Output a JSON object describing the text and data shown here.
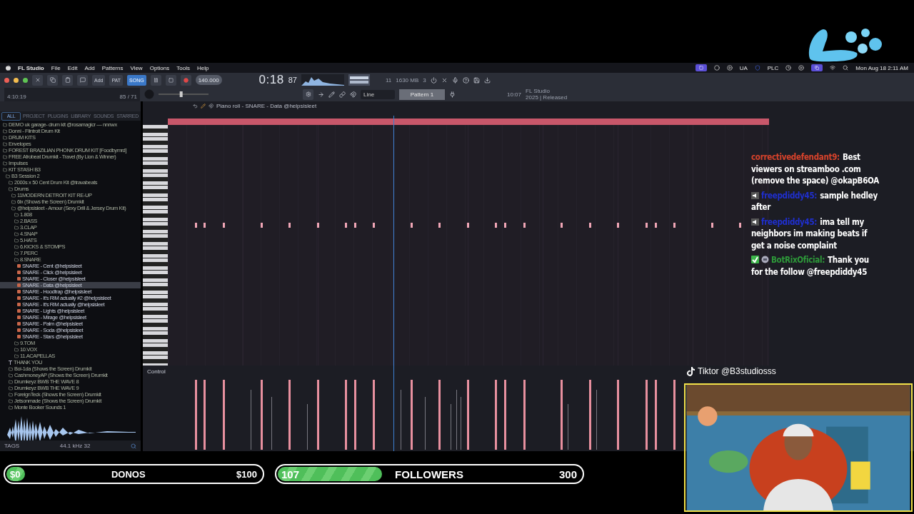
{
  "menu_bar": {
    "app": "FL Studio",
    "items": [
      "File",
      "Edit",
      "Add",
      "Patterns",
      "View",
      "Options",
      "Tools",
      "Help"
    ],
    "status_texts": [
      "UA",
      "PLC"
    ],
    "clock": "Mon Aug 18  2:11 AM"
  },
  "toolbar": {
    "add_label": "Add",
    "modes": [
      {
        "label": "PAT",
        "selected": false
      },
      {
        "label": "SONG",
        "selected": true
      }
    ],
    "tempo": "140.000",
    "pitch": {
      "level": 0.45
    },
    "time_main": "0:18",
    "time_cs": "87",
    "cpu": "11",
    "memory": "1630 MB",
    "voices": "3",
    "hint_time": "4:10:19",
    "hint_counts": "85 / 71",
    "snap": "Line",
    "pattern": "Pattern 1",
    "version_time": "10:07",
    "version_name": "FL Studio",
    "version_release": "2025 | Released"
  },
  "browser": {
    "tabs": [
      {
        "label": "ALL",
        "selected": true
      },
      {
        "label": "PROJECT",
        "selected": false
      },
      {
        "label": "PLUGINS",
        "selected": false
      },
      {
        "label": "LIBRARY",
        "selected": false
      },
      {
        "label": "SOUNDS",
        "selected": false
      },
      {
        "label": "STARRED",
        "selected": false
      }
    ],
    "tree": [
      {
        "kind": "folder",
        "label": "DEMO uk garage- drum kit @rosamagicr — nnnwx"
      },
      {
        "kind": "folder",
        "label": "Donni - Flintroit Drum Kit"
      },
      {
        "kind": "folder",
        "label": "DRUM KITS"
      },
      {
        "kind": "folder",
        "label": "Envelopes"
      },
      {
        "kind": "folder",
        "label": "FOREST BRAZILIAN PHONK DRUM KIT [Foodbymrd]"
      },
      {
        "kind": "folder",
        "label": "FREE Afrobeat Drumkit - Travel (By Lion & Winner)"
      },
      {
        "kind": "folder",
        "label": "Impulses"
      },
      {
        "kind": "folder",
        "label": "KIT STASH B3",
        "children": [
          {
            "kind": "folder",
            "label": "B3 Session 2",
            "children": [
              {
                "kind": "folder",
                "label": "2000s x 50 Cent Drum Kit @travabeats"
              },
              {
                "kind": "folder",
                "label": "Drums",
                "children": [
                  {
                    "kind": "folder",
                    "label": "11MODERN DETROIT KIT RE-UP"
                  },
                  {
                    "kind": "folder",
                    "label": "6ix (Shows the Screen) Drumkit"
                  },
                  {
                    "kind": "folder",
                    "label": "@helpsisleet - Amour (Sexy Drill & Jersey Drum Kit)",
                    "children": [
                      {
                        "kind": "folder",
                        "label": "1.808"
                      },
                      {
                        "kind": "folder",
                        "label": "2.BASS"
                      },
                      {
                        "kind": "folder",
                        "label": "3.CLAP"
                      },
                      {
                        "kind": "folder",
                        "label": "4.SNAP"
                      },
                      {
                        "kind": "folder",
                        "label": "5.HATS"
                      },
                      {
                        "kind": "folder",
                        "label": "6.KICKS & STOMPS"
                      },
                      {
                        "kind": "folder",
                        "label": "7.PERC"
                      },
                      {
                        "kind": "folder",
                        "label": "8.SNARE",
                        "children": [
                          {
                            "kind": "file",
                            "label": "SNARE - Cent @helpsisleet",
                            "selected": false
                          },
                          {
                            "kind": "file",
                            "label": "SNARE - Click @helpsisleet",
                            "selected": false
                          },
                          {
                            "kind": "file",
                            "label": "SNARE - Closer @helpsisleet",
                            "selected": false
                          },
                          {
                            "kind": "file",
                            "label": "SNARE - Data @helpsisleet",
                            "selected": true
                          },
                          {
                            "kind": "file",
                            "label": "SNARE - Hoodtrap @helpsisleet",
                            "selected": false
                          },
                          {
                            "kind": "file",
                            "label": "SNARE - It's RIM actually #2 @helpsisleet",
                            "selected": false
                          },
                          {
                            "kind": "file",
                            "label": "SNARE - It's RIM actually @helpsisleet",
                            "selected": false
                          },
                          {
                            "kind": "file",
                            "label": "SNARE - Lights @helpsisleet",
                            "selected": false
                          },
                          {
                            "kind": "file",
                            "label": "SNARE - Mirage @helpsisleet",
                            "selected": false
                          },
                          {
                            "kind": "file",
                            "label": "SNARE - Palm @helpsisleet",
                            "selected": false
                          },
                          {
                            "kind": "file",
                            "label": "SNARE - Soda @helpsisleet",
                            "selected": false
                          },
                          {
                            "kind": "file",
                            "label": "SNARE - Stars @helpsisleet",
                            "selected": false
                          }
                        ]
                      },
                      {
                        "kind": "folder",
                        "label": "9.TOM"
                      },
                      {
                        "kind": "folder",
                        "label": "10.VOX"
                      },
                      {
                        "kind": "folder",
                        "label": "11.ACAPELLAS"
                      }
                    ]
                  }
                ]
              },
              {
                "kind": "pinned",
                "label": "THANK YOU"
              },
              {
                "kind": "folder",
                "label": "Boi-1da (Shows the Screen) Drumkit"
              },
              {
                "kind": "folder",
                "label": "CashmoneyAP (Shows the Screen) Drumkit"
              },
              {
                "kind": "folder",
                "label": "Drumkeyz BWB THE WAVE 8"
              },
              {
                "kind": "folder",
                "label": "Drumkeyz BWB THE WAVE 9"
              },
              {
                "kind": "folder",
                "label": "ForeignTeck (Shows the Screen) Drumkit"
              },
              {
                "kind": "folder",
                "label": "Jetsonmade (Shows the Screen) Drumkit"
              },
              {
                "kind": "folder",
                "label": "Monte Booker Sounds 1"
              }
            ]
          }
        ]
      }
    ],
    "sample_info": "44.1 kHz 32",
    "tags_label": "TAGS"
  },
  "piano_roll": {
    "title": "Piano roll - SNARE - Data @helpsisleet",
    "control_label": "Control"
  },
  "chat": [
    {
      "kind": "plain",
      "user": "correctivedefendant9:",
      "color": "#d9432b",
      "text": "Best viewers on streamboo .com (remove the space) @okapB6OA"
    },
    {
      "kind": "muted",
      "user": "freepdiddy45:",
      "color": "#1f2fd0",
      "text": "sample hedley after"
    },
    {
      "kind": "muted",
      "user": "freepdiddy45:",
      "color": "#1f2fd0",
      "text": "ima tell my neighbors im making beats if get a noise complaint"
    },
    {
      "kind": "bot",
      "user": "BotRixOficial:",
      "color": "#2e9a3a",
      "text": "Thank you for the follow @freepdiddy45"
    }
  ],
  "stream": {
    "tiktok": "Tiktor @B3studiosss"
  },
  "goals": [
    {
      "start": "$0",
      "label": "DONOS",
      "target": "$100",
      "level": 0
    },
    {
      "start": "107",
      "label": "FOLLOWERS",
      "target": "300",
      "level": 0.35
    }
  ]
}
